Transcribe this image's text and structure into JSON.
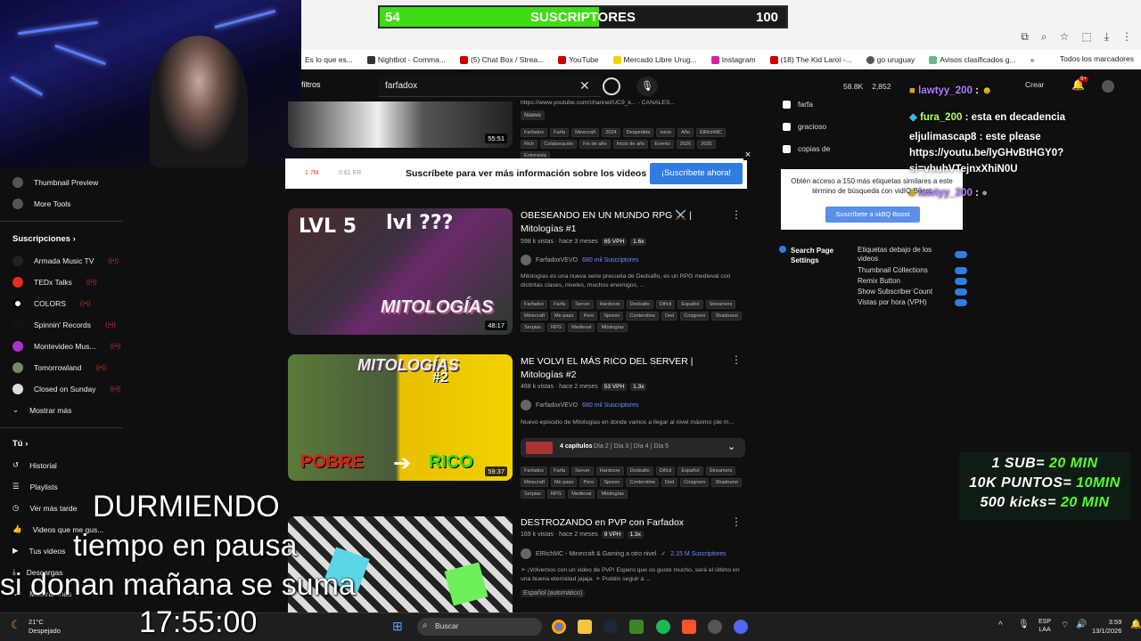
{
  "subgoal": {
    "current": "54",
    "label": "SUSCRIPTORES",
    "goal": "100",
    "progress": 0.54
  },
  "bookmarks": [
    "Es lo que es...",
    "Nightbot - Comma...",
    "(5) Chat Box / Strea...",
    "YouTube",
    "Mercado Libre Urug...",
    "Instagram",
    "(18) The Kid Laroi -...",
    "go uruguay",
    "Avisos clasificados g...",
    "»",
    "Todos los marcadores"
  ],
  "topbar": {
    "filters": "filtros",
    "search_value": "farfadox",
    "views": "58.8K",
    "count": "2,852",
    "create": "Crear",
    "notif": "9+"
  },
  "sidebar": {
    "tools": [
      "Thumbnail Preview",
      "More Tools"
    ],
    "subs_title": "Suscripciones",
    "subs": [
      "Armada Music TV",
      "TEDx Talks",
      "COLORS",
      "Spinnin' Records",
      "Montevideo Mus...",
      "Tomorrowland",
      "Closed on Sunday"
    ],
    "show_more": "Mostrar más",
    "you_title": "Tú",
    "you": [
      "Historial",
      "Playlists",
      "Ver más tarde",
      "Videos que me gus...",
      "Tus videos",
      "Descargas",
      "Mostrar más"
    ]
  },
  "top_result": {
    "url": "https://www.youtube.com/channel/UC9_k... - CANALES...",
    "badge": "Nuevo",
    "tags": [
      "Farfadox",
      "Farfa",
      "Minecraft",
      "2024",
      "Despedida",
      "inicio",
      "Año",
      "ElRichMC",
      "Rich",
      "Colaboración",
      "Fin de año",
      "Inicio de año",
      "Evento",
      "2026",
      "2025",
      "Entrevista"
    ],
    "duration": "55:51"
  },
  "vidiq": {
    "text": "Suscríbete para ver más información sobre los videos",
    "button": "¡Suscríbete ahora!",
    "close": "×",
    "stat1": "1.7M",
    "stat2": "0.61 ER"
  },
  "results": [
    {
      "title": "OBESEANDO EN UN MUNDO RPG ⚔️ | Mitologías #1",
      "meta": "598 k vistas · hace 3 meses",
      "vph": "65 VPH",
      "mult": "1.6x",
      "channel": "FarfadoxVEVO",
      "subs": "680 mil Suscriptores",
      "desc": "Mitologías es una nueva serie precuela de Dedsafio, es un RPG medieval con distintas clases, niveles, muchos enemigos, ...",
      "tags": [
        "Farfadox",
        "Farfa",
        "Server",
        "Hardcore",
        "Dedsafio",
        "Difícil",
        "Español",
        "Streamers",
        "Minecraft",
        "Me paso",
        "Pero",
        "Spreen",
        "Conterstine",
        "Ded",
        "Crisgreen",
        "Shadoune",
        "Serpias",
        "RPG",
        "Medieval",
        "Mitologías"
      ],
      "duration": "48:17",
      "thumb_lvl5": "LVL 5",
      "thumb_lvl": "lvl ???",
      "thumb_logo": "MITOLOGÍAS"
    },
    {
      "title": "ME VOLVI EL MÁS RICO DEL SERVER | Mitologías #2",
      "meta": "468 k vistas · hace 2 meses",
      "vph": "53 VPH",
      "mult": "1.3x",
      "channel": "FarfadoxVEVO",
      "subs": "680 mil Suscriptores",
      "desc": "Nuevo episodio de Mitologías en donde vamos a llegar al nivel máximo (de m...",
      "chapters": "4 capítulos",
      "chapters_list": "Día 2 | Día 3 | Día 4 | Día 5",
      "tags": [
        "Farfadox",
        "Farfa",
        "Server",
        "Hardcore",
        "Dedsafio",
        "Difícil",
        "Español",
        "Streamers",
        "Minecraft",
        "Me paso",
        "Pero",
        "Spreen",
        "Conterstine",
        "Ded",
        "Crisgreen",
        "Shadoune",
        "Serpias",
        "RPG",
        "Medieval",
        "Mitologías"
      ],
      "duration": "59:37",
      "thumb_left": "POBRE",
      "thumb_right": "RICO",
      "thumb_logo": "MITOLOGÍAS",
      "thumb_num": "#2"
    },
    {
      "title": "DESTROZANDO en PVP con Farfadox",
      "meta": "169 k vistas · hace 2 meses",
      "vph": "9 VPH",
      "mult": "1.3x",
      "channel": "ElRichMC - Minecraft & Gaming a otro nivel",
      "subs": "2.15 M Suscriptores",
      "desc": "➣ ¡Volvemos con un video de PvP! Espero que os guste mucho, será el último en una buena eternidad jajaja. ➣ Podéis seguir a ...",
      "lang": "Español (automático)"
    }
  ],
  "panel": {
    "checks": [
      "farfa",
      "gracioso",
      "copias de"
    ],
    "promo": "Obtén acceso a 150 más etiquetas similares a este término de búsqueda con vidIQ Boost",
    "promo_btn": "Suscríbete a vidIQ Boost",
    "settings_title": "Search Page Settings",
    "settings": [
      "Etiquetas debajo de los videos",
      "Thumbnail Collections",
      "Remix Button",
      "Show Subscriber Count",
      "Vistas por hora (VPH)"
    ]
  },
  "chat": [
    {
      "user": "lawtyy_200",
      "msg": ":"
    },
    {
      "user": "fura_200",
      "msg": ": esta en decadencia"
    },
    {
      "user": "eljulimascap8",
      "msg": ": este please"
    },
    {
      "user": "",
      "msg": "https://youtu.be/lyGHvBtHGY0?"
    },
    {
      "user": "",
      "msg": "si=vbuhVTejnxXhiN0U"
    },
    {
      "user": "lawtyy_200",
      "msg": ":"
    }
  ],
  "timer_rules": [
    {
      "left": "1 SUB= ",
      "right": "20 MIN"
    },
    {
      "left": "10K PUNTOS= ",
      "right": "10MIN"
    },
    {
      "left": "500 kicks= ",
      "right": "20 MIN"
    }
  ],
  "overlay": {
    "line1": "DURMIENDO",
    "line2": "tiempo en pausa",
    "line3": "si donan mañana se suma",
    "time": "17:55:00"
  },
  "taskbar": {
    "weather_temp": "21°C",
    "weather_desc": "Despejado",
    "search": "Buscar",
    "lang1": "ESP",
    "lang2": "LAA",
    "time": "3:59",
    "date": "13/1/2026"
  },
  "colors": {
    "accent_green": "#52ff2c",
    "vidiq_blue": "#2f7de1",
    "yt_bg": "#0f0f0f"
  }
}
